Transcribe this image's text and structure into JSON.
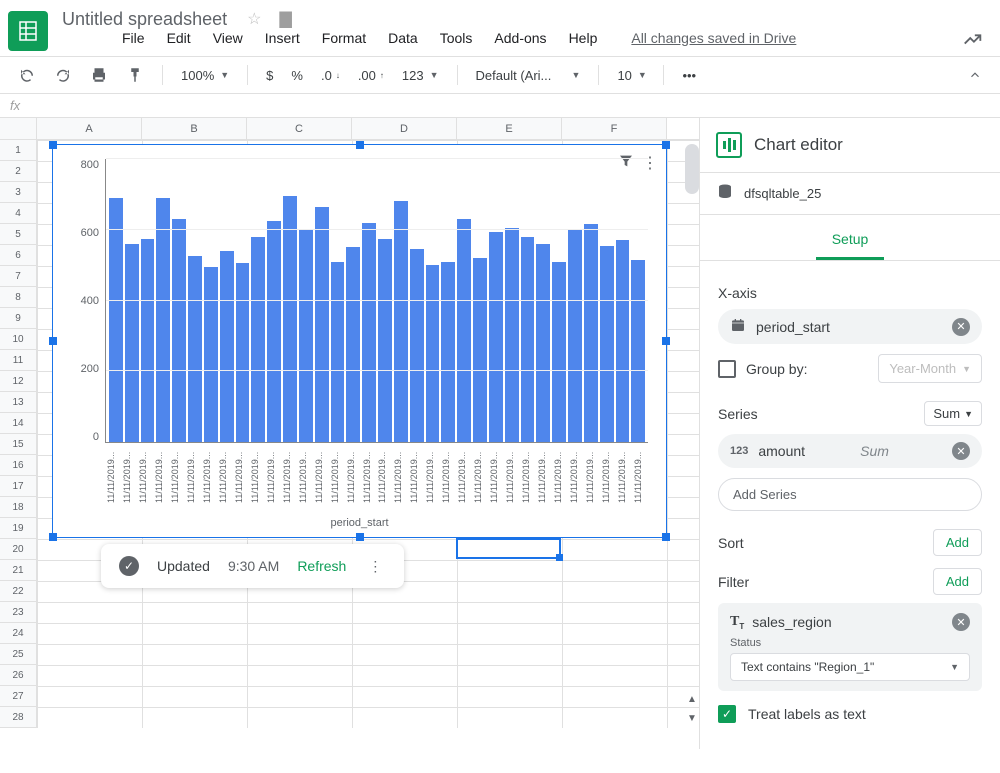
{
  "header": {
    "doc_title": "Untitled spreadsheet",
    "menus": [
      "File",
      "Edit",
      "View",
      "Insert",
      "Format",
      "Data",
      "Tools",
      "Add-ons",
      "Help"
    ],
    "changes_saved": "All changes saved in Drive"
  },
  "toolbar": {
    "zoom": "100%",
    "font": "Default (Ari...",
    "font_size": "10",
    "num123": "123"
  },
  "fx_label": "fx",
  "grid": {
    "columns": [
      "A",
      "B",
      "C",
      "D",
      "E",
      "F"
    ],
    "row_count": 28,
    "active_cell": {
      "col_index": 4,
      "row_index": 19
    }
  },
  "chart_data": {
    "type": "bar",
    "xlabel": "period_start",
    "ylabel": "",
    "ylim": [
      0,
      800
    ],
    "yticks": [
      0,
      200,
      400,
      600,
      800
    ],
    "categories": [
      "11/11/2019...",
      "11/11/2019...",
      "11/11/2019...",
      "11/11/2019...",
      "11/11/2019...",
      "11/11/2019...",
      "11/11/2019...",
      "11/11/2019...",
      "11/11/2019...",
      "11/11/2019...",
      "11/11/2019...",
      "11/11/2019...",
      "11/11/2019...",
      "11/11/2019...",
      "11/11/2019...",
      "11/11/2019...",
      "11/11/2019...",
      "11/11/2019...",
      "11/11/2019...",
      "11/11/2019...",
      "11/11/2019...",
      "11/11/2019...",
      "11/11/2019...",
      "11/11/2019...",
      "11/11/2019...",
      "11/11/2019...",
      "11/11/2019...",
      "11/11/2019...",
      "11/11/2019...",
      "11/11/2019...",
      "11/11/2019...",
      "11/11/2019...",
      "11/11/2019...",
      "11/11/2019..."
    ],
    "values": [
      690,
      560,
      575,
      690,
      630,
      525,
      495,
      540,
      505,
      580,
      625,
      695,
      600,
      665,
      510,
      550,
      620,
      575,
      680,
      545,
      500,
      510,
      630,
      520,
      595,
      605,
      580,
      560,
      510,
      600,
      615,
      555,
      570,
      515
    ]
  },
  "status": {
    "label": "Updated",
    "time": "9:30 AM",
    "refresh": "Refresh"
  },
  "sidebar": {
    "title": "Chart editor",
    "data_source": "dfsqltable_25",
    "tab_setup": "Setup",
    "xaxis_label": "X-axis",
    "xaxis_field": "period_start",
    "group_by_label": "Group by:",
    "group_by_placeholder": "Year-Month",
    "series_label": "Series",
    "series_agg": "Sum",
    "series_field": "amount",
    "series_field_agg": "Sum",
    "add_series": "Add Series",
    "sort_label": "Sort",
    "filter_label": "Filter",
    "add_btn": "Add",
    "filter_field": "sales_region",
    "filter_status_label": "Status",
    "filter_status_value": "Text contains \"Region_1\"",
    "treat_labels": "Treat labels as text"
  }
}
